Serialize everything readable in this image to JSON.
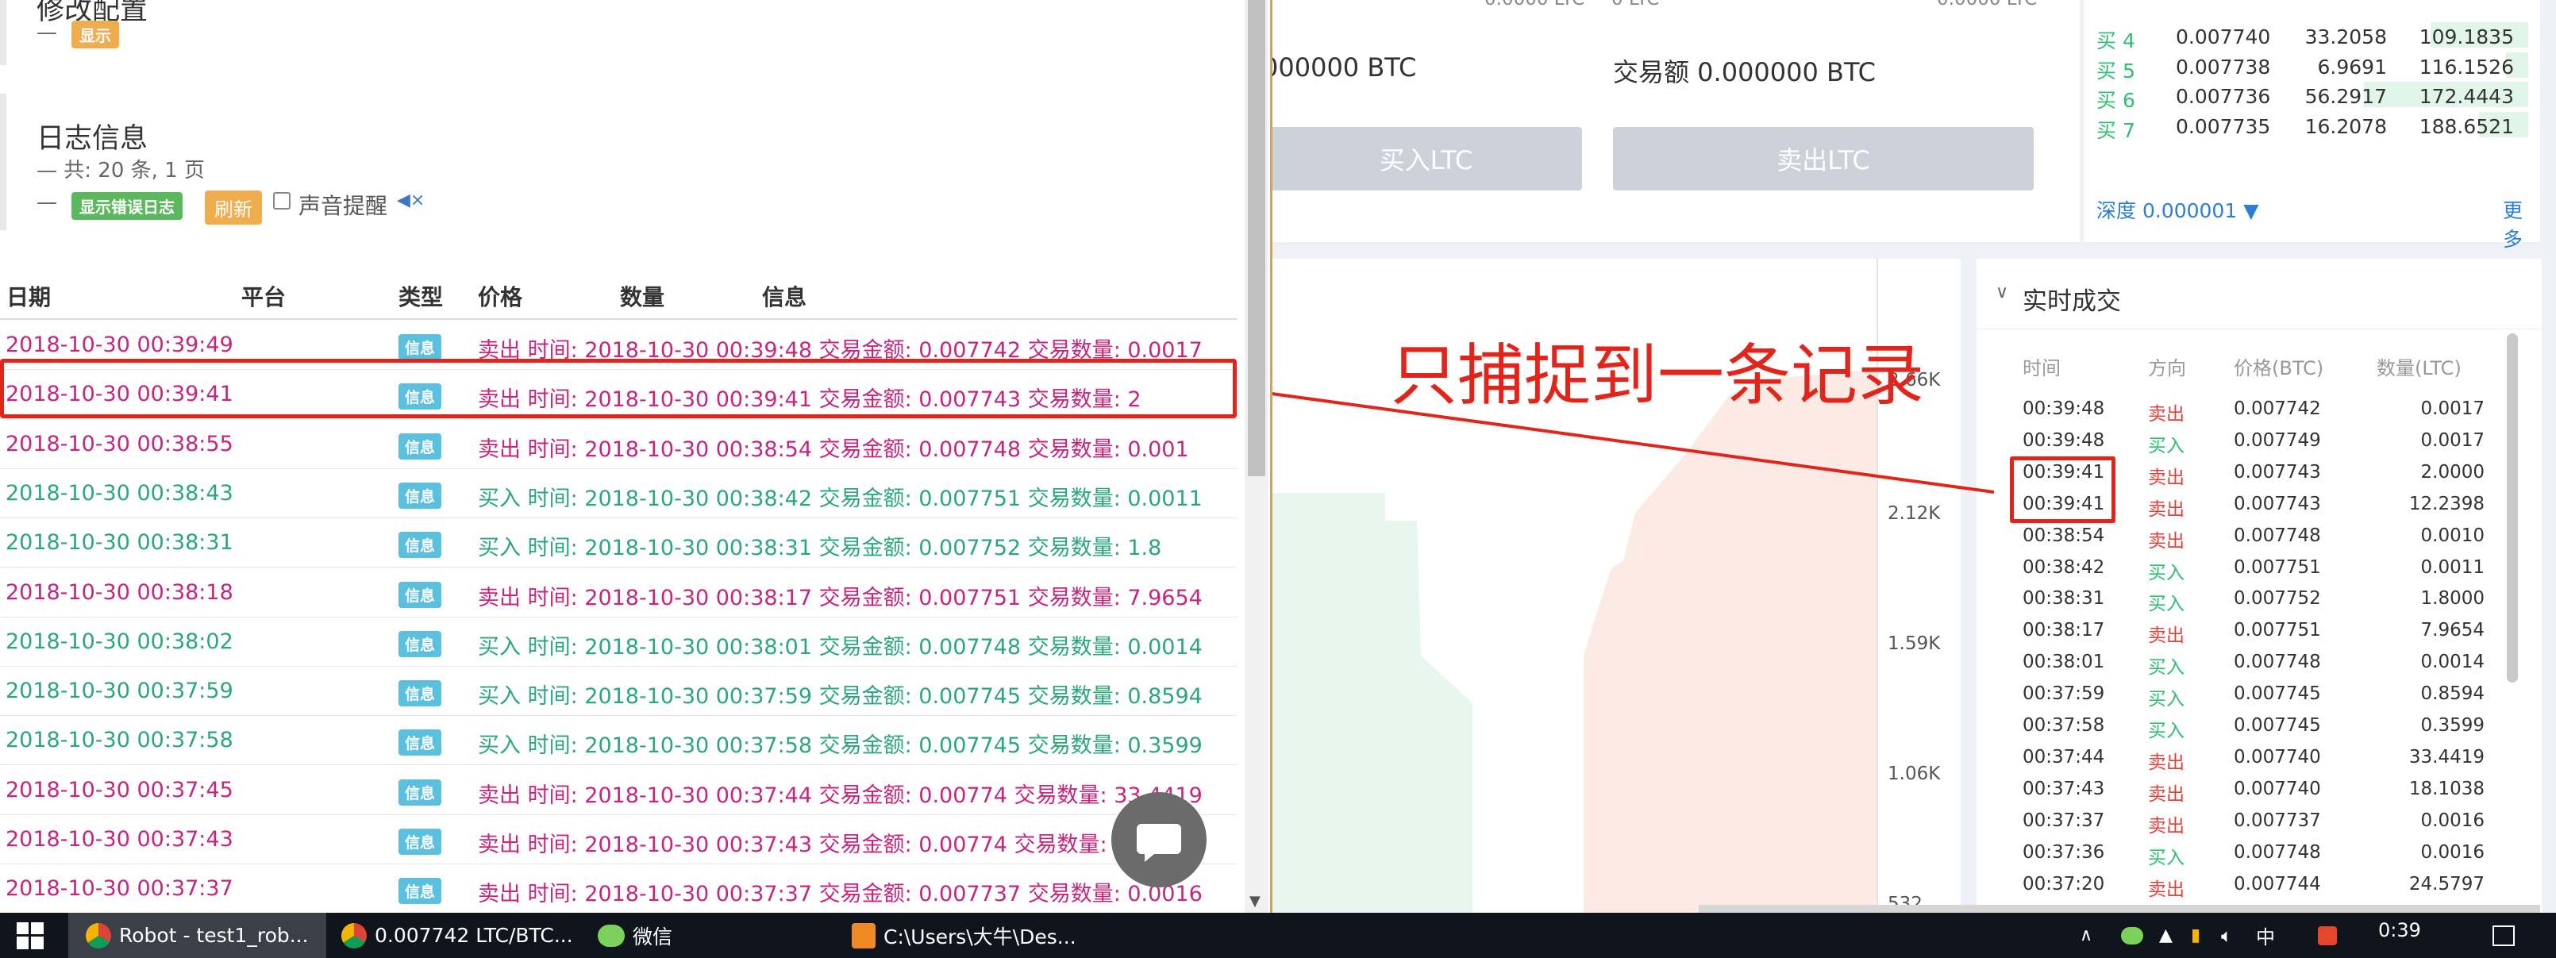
{
  "exchange": {
    "top_partial_left": "0.0000 LTC",
    "top_partial_mid": "0 LTC",
    "top_partial_right": "0.0000 LTC",
    "trade_amount_left": "000000 BTC",
    "trade_amount_right": "交易额 0.000000 BTC",
    "buy_button": "买入LTC",
    "sell_button": "卖出LTC",
    "order_book": [
      {
        "label": "买 4",
        "price": "0.007740",
        "amount": "33.2058",
        "total": "109.1835",
        "depth": 0.22
      },
      {
        "label": "买 5",
        "price": "0.007738",
        "amount": "6.9691",
        "total": "116.1526",
        "depth": 0.05
      },
      {
        "label": "买 6",
        "price": "0.007736",
        "amount": "56.2917",
        "total": "172.4443",
        "depth": 0.37
      },
      {
        "label": "买 7",
        "price": "0.007735",
        "amount": "16.2078",
        "total": "188.6521",
        "depth": 0.11
      }
    ],
    "depth_selector": "深度 0.000001",
    "more_link": "更多",
    "chart_ticks": [
      "2.66K",
      "2.12K",
      "1.59K",
      "1.06K",
      "532"
    ],
    "realtime": {
      "title": "实时成交",
      "headers": [
        "时间",
        "方向",
        "价格(BTC)",
        "数量(LTC)"
      ],
      "rows": [
        {
          "time": "00:39:48",
          "side": "卖出",
          "price": "0.007742",
          "qty": "0.0017",
          "sell": true
        },
        {
          "time": "00:39:48",
          "side": "买入",
          "price": "0.007749",
          "qty": "0.0017",
          "sell": false
        },
        {
          "time": "00:39:41",
          "side": "卖出",
          "price": "0.007743",
          "qty": "2.0000",
          "sell": true
        },
        {
          "time": "00:39:41",
          "side": "卖出",
          "price": "0.007743",
          "qty": "12.2398",
          "sell": true
        },
        {
          "time": "00:38:54",
          "side": "卖出",
          "price": "0.007748",
          "qty": "0.0010",
          "sell": true
        },
        {
          "time": "00:38:42",
          "side": "买入",
          "price": "0.007751",
          "qty": "0.0011",
          "sell": false
        },
        {
          "time": "00:38:31",
          "side": "买入",
          "price": "0.007752",
          "qty": "1.8000",
          "sell": false
        },
        {
          "time": "00:38:17",
          "side": "卖出",
          "price": "0.007751",
          "qty": "7.9654",
          "sell": true
        },
        {
          "time": "00:38:01",
          "side": "买入",
          "price": "0.007748",
          "qty": "0.0014",
          "sell": false
        },
        {
          "time": "00:37:59",
          "side": "买入",
          "price": "0.007745",
          "qty": "0.8594",
          "sell": false
        },
        {
          "time": "00:37:58",
          "side": "买入",
          "price": "0.007745",
          "qty": "0.3599",
          "sell": false
        },
        {
          "time": "00:37:44",
          "side": "卖出",
          "price": "0.007740",
          "qty": "33.4419",
          "sell": true
        },
        {
          "time": "00:37:43",
          "side": "卖出",
          "price": "0.007740",
          "qty": "18.1038",
          "sell": true
        },
        {
          "time": "00:37:37",
          "side": "卖出",
          "price": "0.007737",
          "qty": "0.0016",
          "sell": true
        },
        {
          "time": "00:37:36",
          "side": "买入",
          "price": "0.007748",
          "qty": "0.0016",
          "sell": false
        },
        {
          "time": "00:37:20",
          "side": "卖出",
          "price": "0.007744",
          "qty": "24.5797",
          "sell": true
        }
      ]
    }
  },
  "annotation": {
    "text": "只捕捉到一条记录",
    "color": "#e3241b"
  },
  "logwin": {
    "section1_title": "修改配置",
    "section1_dash": "—",
    "section1_badge": "显示",
    "section2_title": "日志信息",
    "summary": "— 共: 20 条, 1 页",
    "dash": "—",
    "error_log_button": "显示错误日志",
    "refresh_button": "刷新",
    "sound_alert_label": "声音提醒",
    "headers": [
      "日期",
      "平台",
      "类型",
      "价格",
      "数量",
      "信息"
    ],
    "type_badge": "信息",
    "rows": [
      {
        "date": "2018-10-30 00:39:49",
        "msg": "卖出 时间: 2018-10-30 00:39:48 交易金额: 0.007742 交易数量: 0.0017",
        "sell": true
      },
      {
        "date": "2018-10-30 00:39:41",
        "msg": "卖出 时间: 2018-10-30 00:39:41 交易金额: 0.007743 交易数量: 2",
        "sell": true
      },
      {
        "date": "2018-10-30 00:38:55",
        "msg": "卖出 时间: 2018-10-30 00:38:54 交易金额: 0.007748 交易数量: 0.001",
        "sell": true
      },
      {
        "date": "2018-10-30 00:38:43",
        "msg": "买入 时间: 2018-10-30 00:38:42 交易金额: 0.007751 交易数量: 0.0011",
        "sell": false
      },
      {
        "date": "2018-10-30 00:38:31",
        "msg": "买入 时间: 2018-10-30 00:38:31 交易金额: 0.007752 交易数量: 1.8",
        "sell": false
      },
      {
        "date": "2018-10-30 00:38:18",
        "msg": "卖出 时间: 2018-10-30 00:38:17 交易金额: 0.007751 交易数量: 7.9654",
        "sell": true
      },
      {
        "date": "2018-10-30 00:38:02",
        "msg": "买入 时间: 2018-10-30 00:38:01 交易金额: 0.007748 交易数量: 0.0014",
        "sell": false
      },
      {
        "date": "2018-10-30 00:37:59",
        "msg": "买入 时间: 2018-10-30 00:37:59 交易金额: 0.007745 交易数量: 0.8594",
        "sell": false
      },
      {
        "date": "2018-10-30 00:37:58",
        "msg": "买入 时间: 2018-10-30 00:37:58 交易金额: 0.007745 交易数量: 0.3599",
        "sell": false
      },
      {
        "date": "2018-10-30 00:37:45",
        "msg": "卖出 时间: 2018-10-30 00:37:44 交易金额: 0.00774 交易数量: 33.4419",
        "sell": true
      },
      {
        "date": "2018-10-30 00:37:43",
        "msg": "卖出 时间: 2018-10-30 00:37:43 交易金额: 0.00774 交易数量: 18.1038",
        "sell": true
      },
      {
        "date": "2018-10-30 00:37:37",
        "msg": "卖出 时间: 2018-10-30 00:37:37 交易金额: 0.007737 交易数量: 0.0016",
        "sell": true
      }
    ]
  },
  "taskbar": {
    "items": [
      "Robot - test1_rob...",
      "0.007742 LTC/BTC...",
      "微信",
      "C:\\Users\\大牛\\Des..."
    ],
    "tray_ime": "中",
    "clock": "0:39"
  }
}
